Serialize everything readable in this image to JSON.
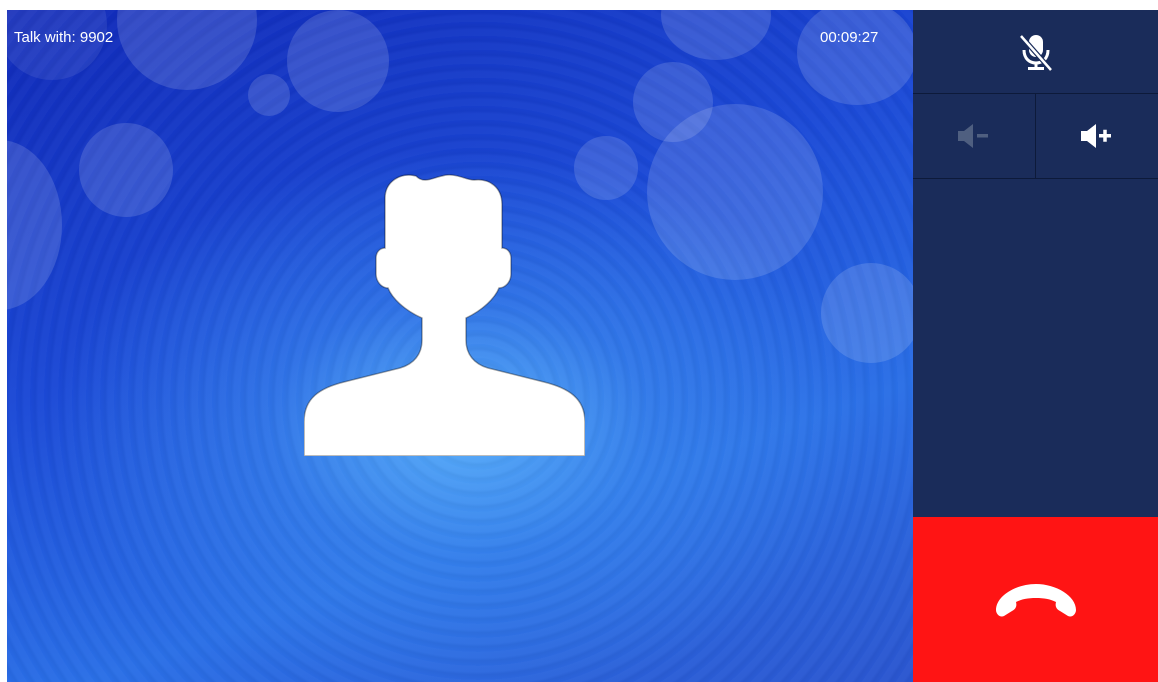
{
  "call": {
    "talk_label": "Talk with: 9902",
    "timer": "00:09:27"
  },
  "controls": {
    "mute_icon": "mic-muted-icon",
    "volume_down_icon": "volume-down-icon",
    "volume_down_enabled": false,
    "volume_up_icon": "volume-up-icon",
    "hangup_icon": "phone-hangup-icon"
  },
  "colors": {
    "panel": "#1a2c5a",
    "hangup": "#ff1414",
    "background_blue": "#1b49d6"
  }
}
